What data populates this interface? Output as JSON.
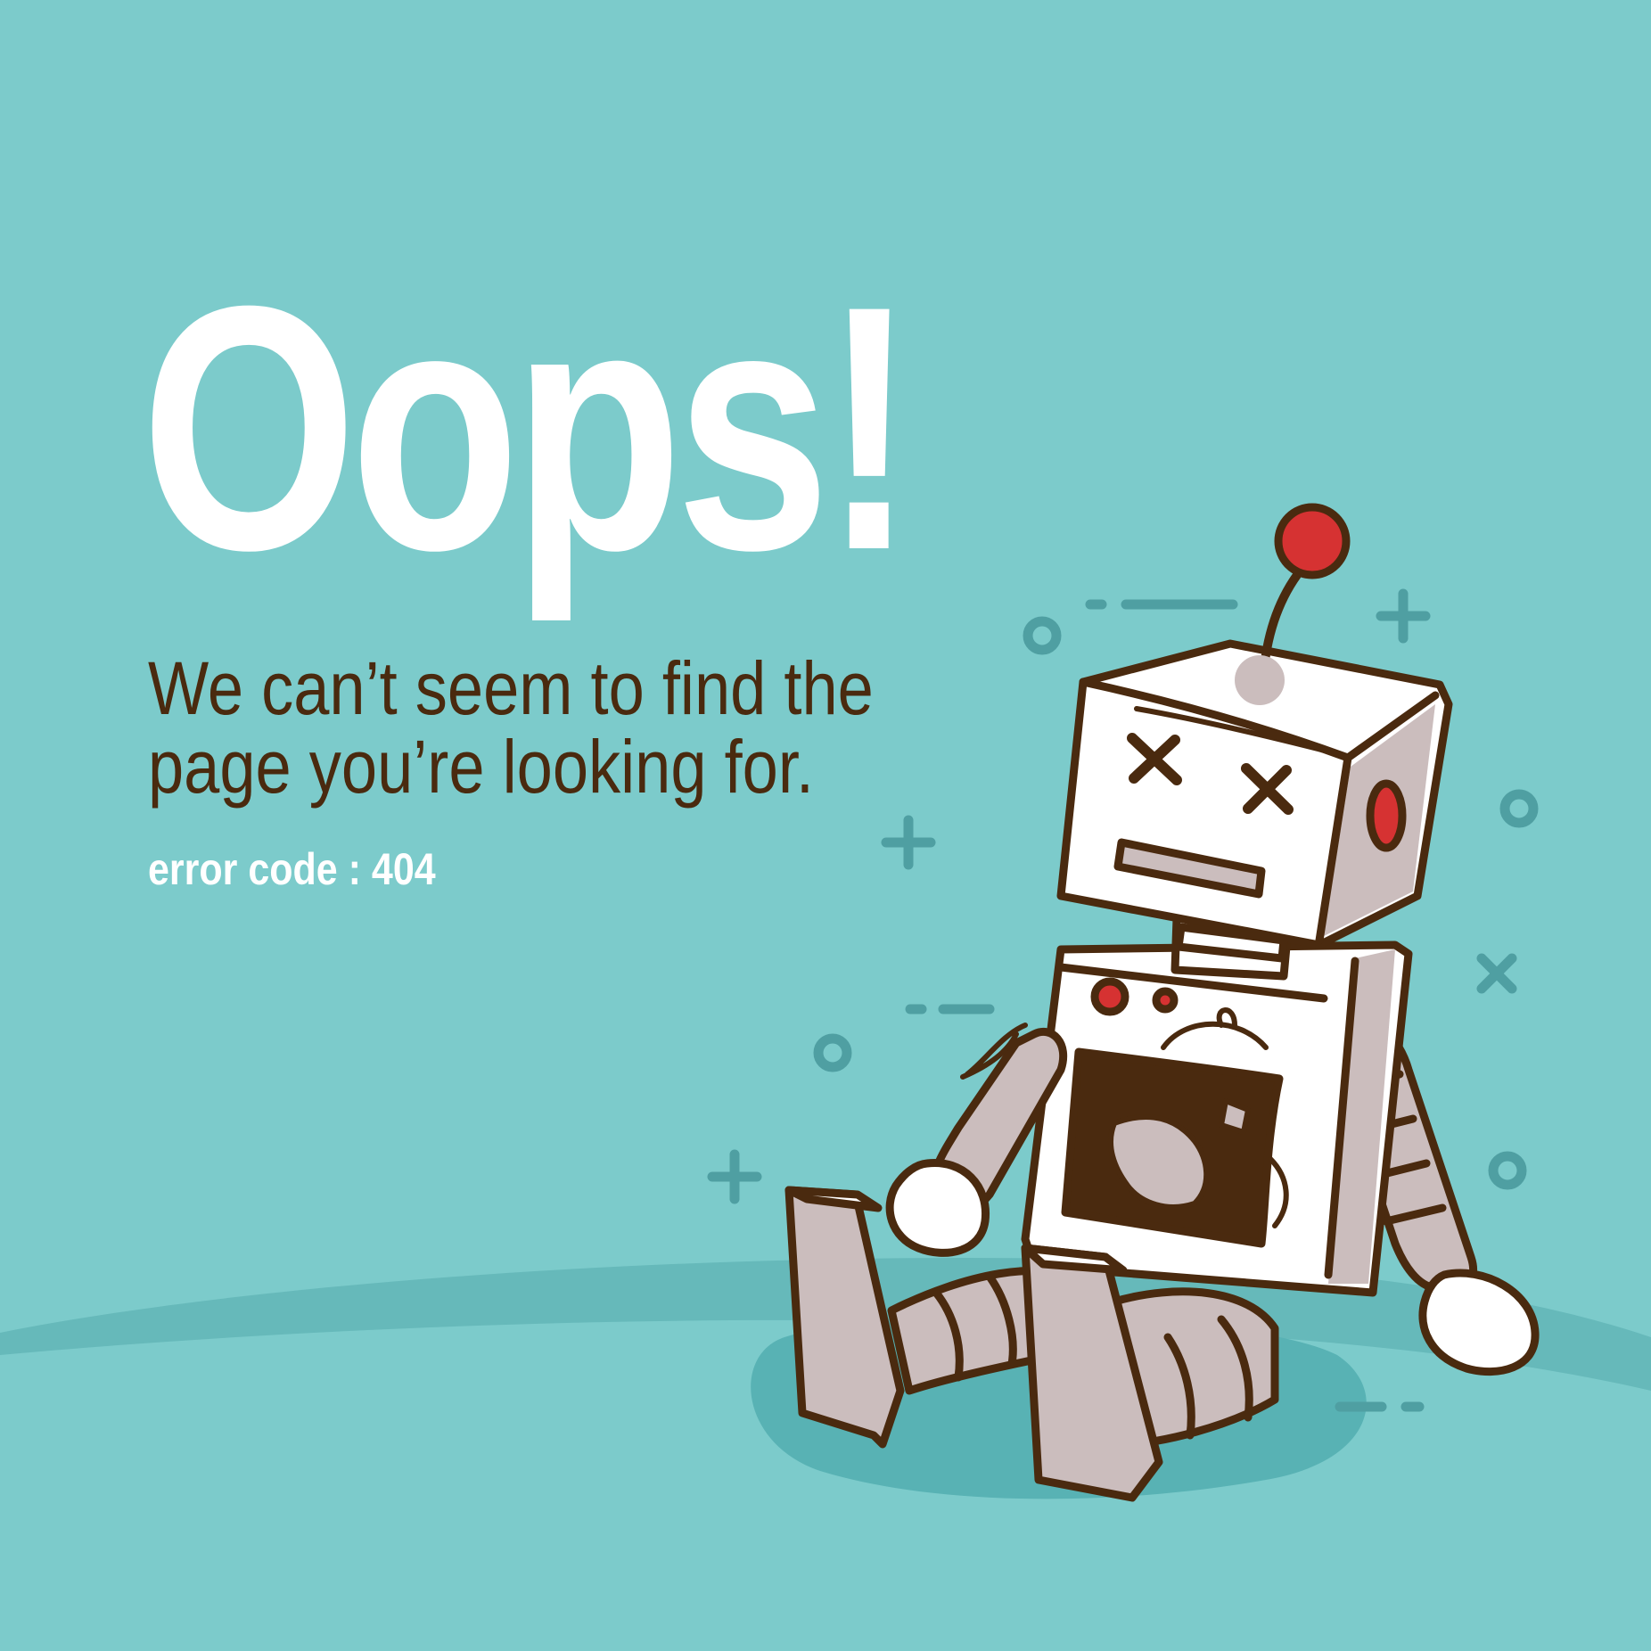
{
  "page": {
    "headline": "Oops!",
    "message_line_1": "We can’t seem to find the",
    "message_line_2": "page you’re looking for.",
    "error_code": "error code : 404"
  },
  "colors": {
    "background": "#7ccbcb",
    "ground": "#66b9ba",
    "shadow": "#58b2b4",
    "decoration": "#4f9fa2",
    "headline": "#ffffff",
    "message": "#4a2a0f",
    "error_code": "#ffffff",
    "robot_outline": "#4a2a0f",
    "robot_body": "#ffffff",
    "robot_shade": "#cbbdbd",
    "robot_accent": "#d63232"
  },
  "illustration": {
    "subject": "broken-robot",
    "decorations": [
      "plus-icon",
      "circle-icon",
      "cross-icon",
      "dash-line"
    ]
  }
}
